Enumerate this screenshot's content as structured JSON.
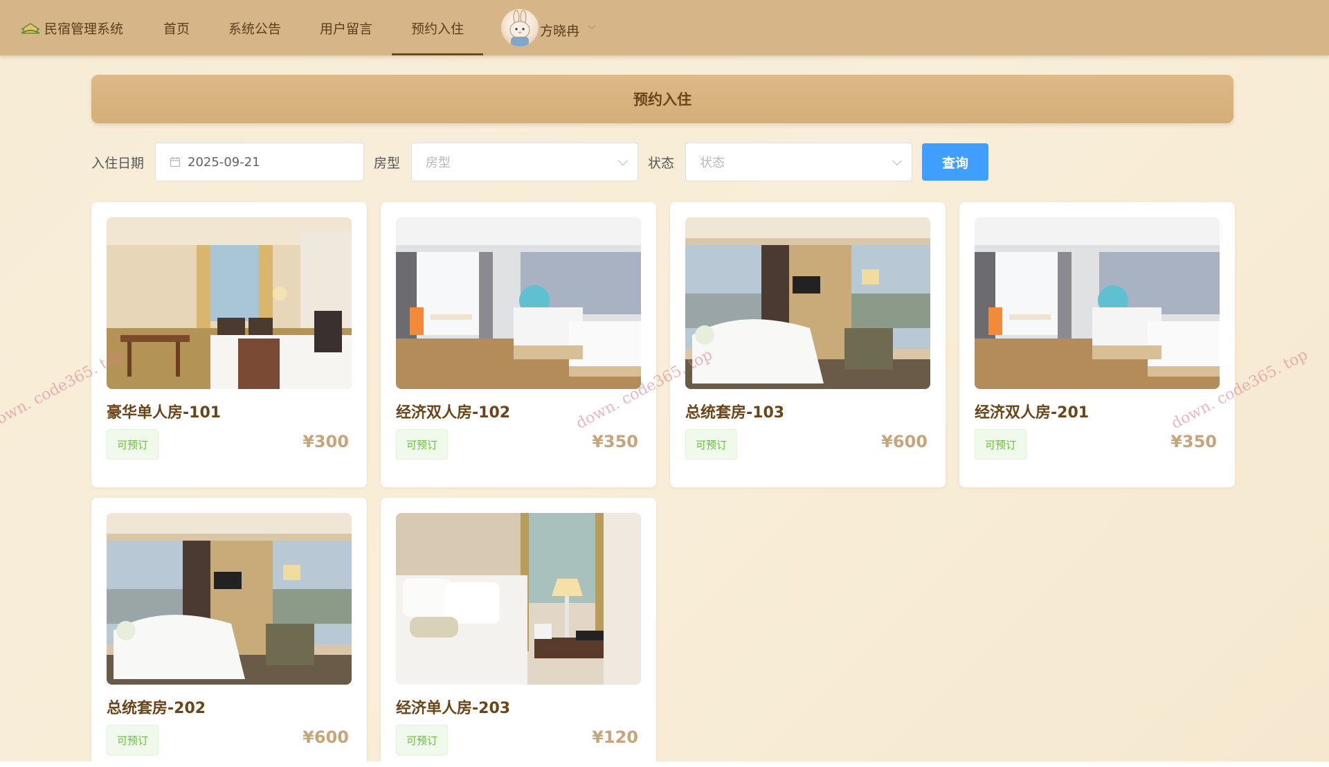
{
  "nav": {
    "brand": "民宿管理系统",
    "items": [
      {
        "label": "首页",
        "active": false
      },
      {
        "label": "系统公告",
        "active": false
      },
      {
        "label": "用户留言",
        "active": false
      },
      {
        "label": "预约入住",
        "active": true
      }
    ],
    "username": "方晓冉"
  },
  "page": {
    "title": "预约入住"
  },
  "filters": {
    "date_label": "入住日期",
    "date_value": "2025-09-21",
    "room_type_label": "房型",
    "room_type_placeholder": "房型",
    "status_label": "状态",
    "status_placeholder": "状态",
    "query_button": "查询"
  },
  "rooms": [
    {
      "name": "豪华单人房-101",
      "status": "可预订",
      "price": "¥300"
    },
    {
      "name": "经济双人房-102",
      "status": "可预订",
      "price": "¥350"
    },
    {
      "name": "总统套房-103",
      "status": "可预订",
      "price": "¥600"
    },
    {
      "name": "经济双人房-201",
      "status": "可预订",
      "price": "¥350"
    },
    {
      "name": "总统套房-202",
      "status": "可预订",
      "price": "¥600"
    },
    {
      "name": "经济单人房-203",
      "status": "可预订",
      "price": "¥120"
    }
  ],
  "watermark": "down. code365. top",
  "colors": {
    "nav_bg": "#d6b688",
    "banner_bg": "#d5ae78",
    "accent_text": "#6b4418",
    "primary_button": "#409eff",
    "status_green": "#67c23a",
    "price": "#c7a57b"
  }
}
